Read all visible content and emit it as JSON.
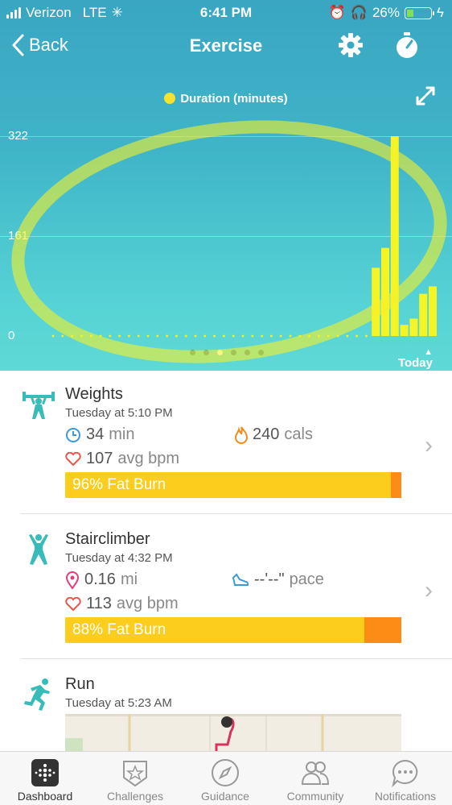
{
  "status": {
    "carrier": "Verizon",
    "network": "LTE",
    "time": "6:41 PM",
    "battery": "26%"
  },
  "nav": {
    "back": "Back",
    "title": "Exercise"
  },
  "legend": "Duration (minutes)",
  "chart_data": {
    "type": "bar",
    "title": "Duration (minutes)",
    "yticks": [
      "322",
      "161",
      "0"
    ],
    "ylim": [
      0,
      322
    ],
    "values": [
      0,
      0,
      0,
      0,
      0,
      0,
      0,
      0,
      0,
      0,
      0,
      0,
      0,
      0,
      0,
      0,
      0,
      0,
      0,
      0,
      0,
      0,
      0,
      0,
      0,
      0,
      0,
      0,
      0,
      0,
      0,
      0,
      0,
      0,
      110,
      142,
      322,
      18,
      28,
      68,
      80
    ],
    "xlabel_end": "Today"
  },
  "accent": {
    "bar": "#f5f526",
    "fat": "#fccd1c",
    "peak": "#fc8c16",
    "teal": "#3fb4c8"
  },
  "activities": [
    {
      "name": "Weights",
      "when": "Tuesday at 5:10 PM",
      "s1": "34",
      "s1u": "min",
      "s2": "240",
      "s2u": "cals",
      "s3": "107",
      "s3u": "avg bpm",
      "fat": "96% Fat Burn",
      "fatPct": 96
    },
    {
      "name": "Stairclimber",
      "when": "Tuesday at 4:32 PM",
      "s1": "0.16",
      "s1u": "mi",
      "s2": "--'--\"",
      "s2u": "pace",
      "s3": "113",
      "s3u": "avg bpm",
      "fat": "88% Fat Burn",
      "fatPct": 88
    },
    {
      "name": "Run",
      "when": "Tuesday at 5:23 AM"
    }
  ],
  "tabs": [
    "Dashboard",
    "Challenges",
    "Guidance",
    "Community",
    "Notifications"
  ]
}
